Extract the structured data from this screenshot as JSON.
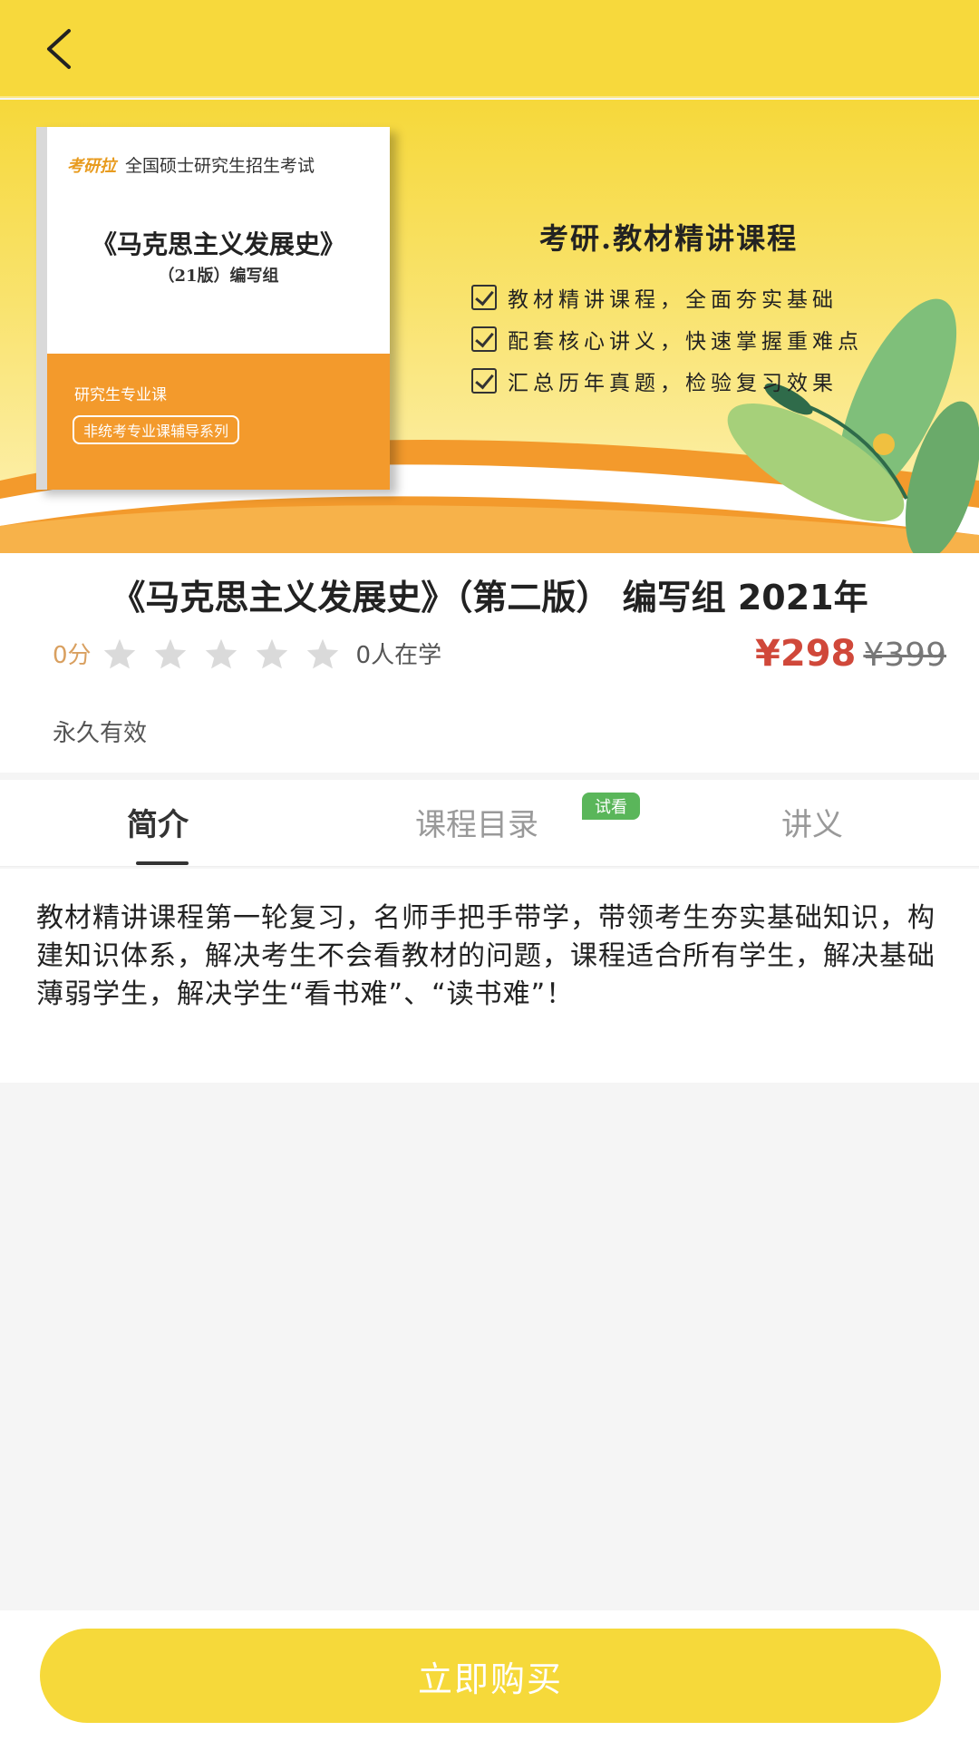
{
  "header": {
    "back_icon": "chevron-left-icon"
  },
  "banner": {
    "book": {
      "logo": "考研拉",
      "header": "全国硕士研究生招生考试",
      "title": "《马克思主义发展史》",
      "subtitle": "（21版）编写组",
      "tag1": "研究生专业课",
      "tag2": "非统考专业课辅导系列"
    },
    "heading": "考研.教材精讲课程",
    "points": [
      "教材精讲课程，全面夯实基础",
      "配套核心讲义，快速掌握重难点",
      "汇总历年真题，检验复习效果"
    ]
  },
  "course": {
    "title": "《马克思主义发展史》（第二版） 编写组 2021年",
    "score": "0分",
    "stars": 0,
    "learners": "0人在学",
    "price": "¥298",
    "original_price": "¥399",
    "validity": "永久有效"
  },
  "tabs": [
    {
      "label": "简介",
      "active": true
    },
    {
      "label": "课程目录",
      "badge": "试看"
    },
    {
      "label": "讲义"
    }
  ],
  "intro": {
    "text": "教材精讲课程第一轮复习，名师手把手带学，带领考生夯实基础知识，构建知识体系，解决考生不会看教材的问题，课程适合所有学生，解决基础薄弱学生，解决学生“看书难”、“读书难”！"
  },
  "footer": {
    "buy_label": "立即购买"
  },
  "colors": {
    "brand_yellow": "#f6d93a",
    "price_red": "#d0483a",
    "badge_green": "#5ab65a",
    "banner_orange": "#f39a2c"
  }
}
